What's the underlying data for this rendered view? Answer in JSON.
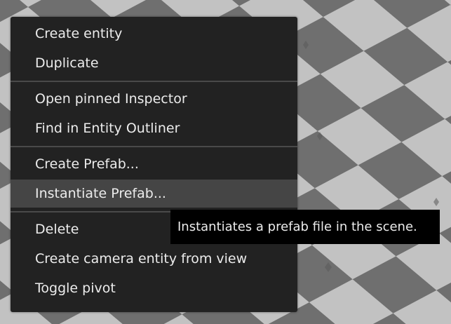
{
  "context_menu": {
    "groups": [
      {
        "items": [
          {
            "label": "Create entity"
          },
          {
            "label": "Duplicate"
          }
        ]
      },
      {
        "items": [
          {
            "label": "Open pinned Inspector"
          },
          {
            "label": "Find in Entity Outliner"
          }
        ]
      },
      {
        "items": [
          {
            "label": "Create Prefab..."
          },
          {
            "label": "Instantiate Prefab...",
            "hovered": true
          }
        ]
      },
      {
        "items": [
          {
            "label": "Delete"
          },
          {
            "label": "Create camera entity from view"
          },
          {
            "label": "Toggle pivot"
          }
        ]
      }
    ]
  },
  "tooltip": {
    "text": "Instantiates a prefab file in the scene."
  },
  "colors": {
    "viewport_light_tile": "#c2c2c2",
    "viewport_dark_tile": "#6f6f6f",
    "menu_background": "#222222",
    "menu_hover": "#454545",
    "menu_text": "#ececec",
    "tooltip_background": "#000000"
  }
}
